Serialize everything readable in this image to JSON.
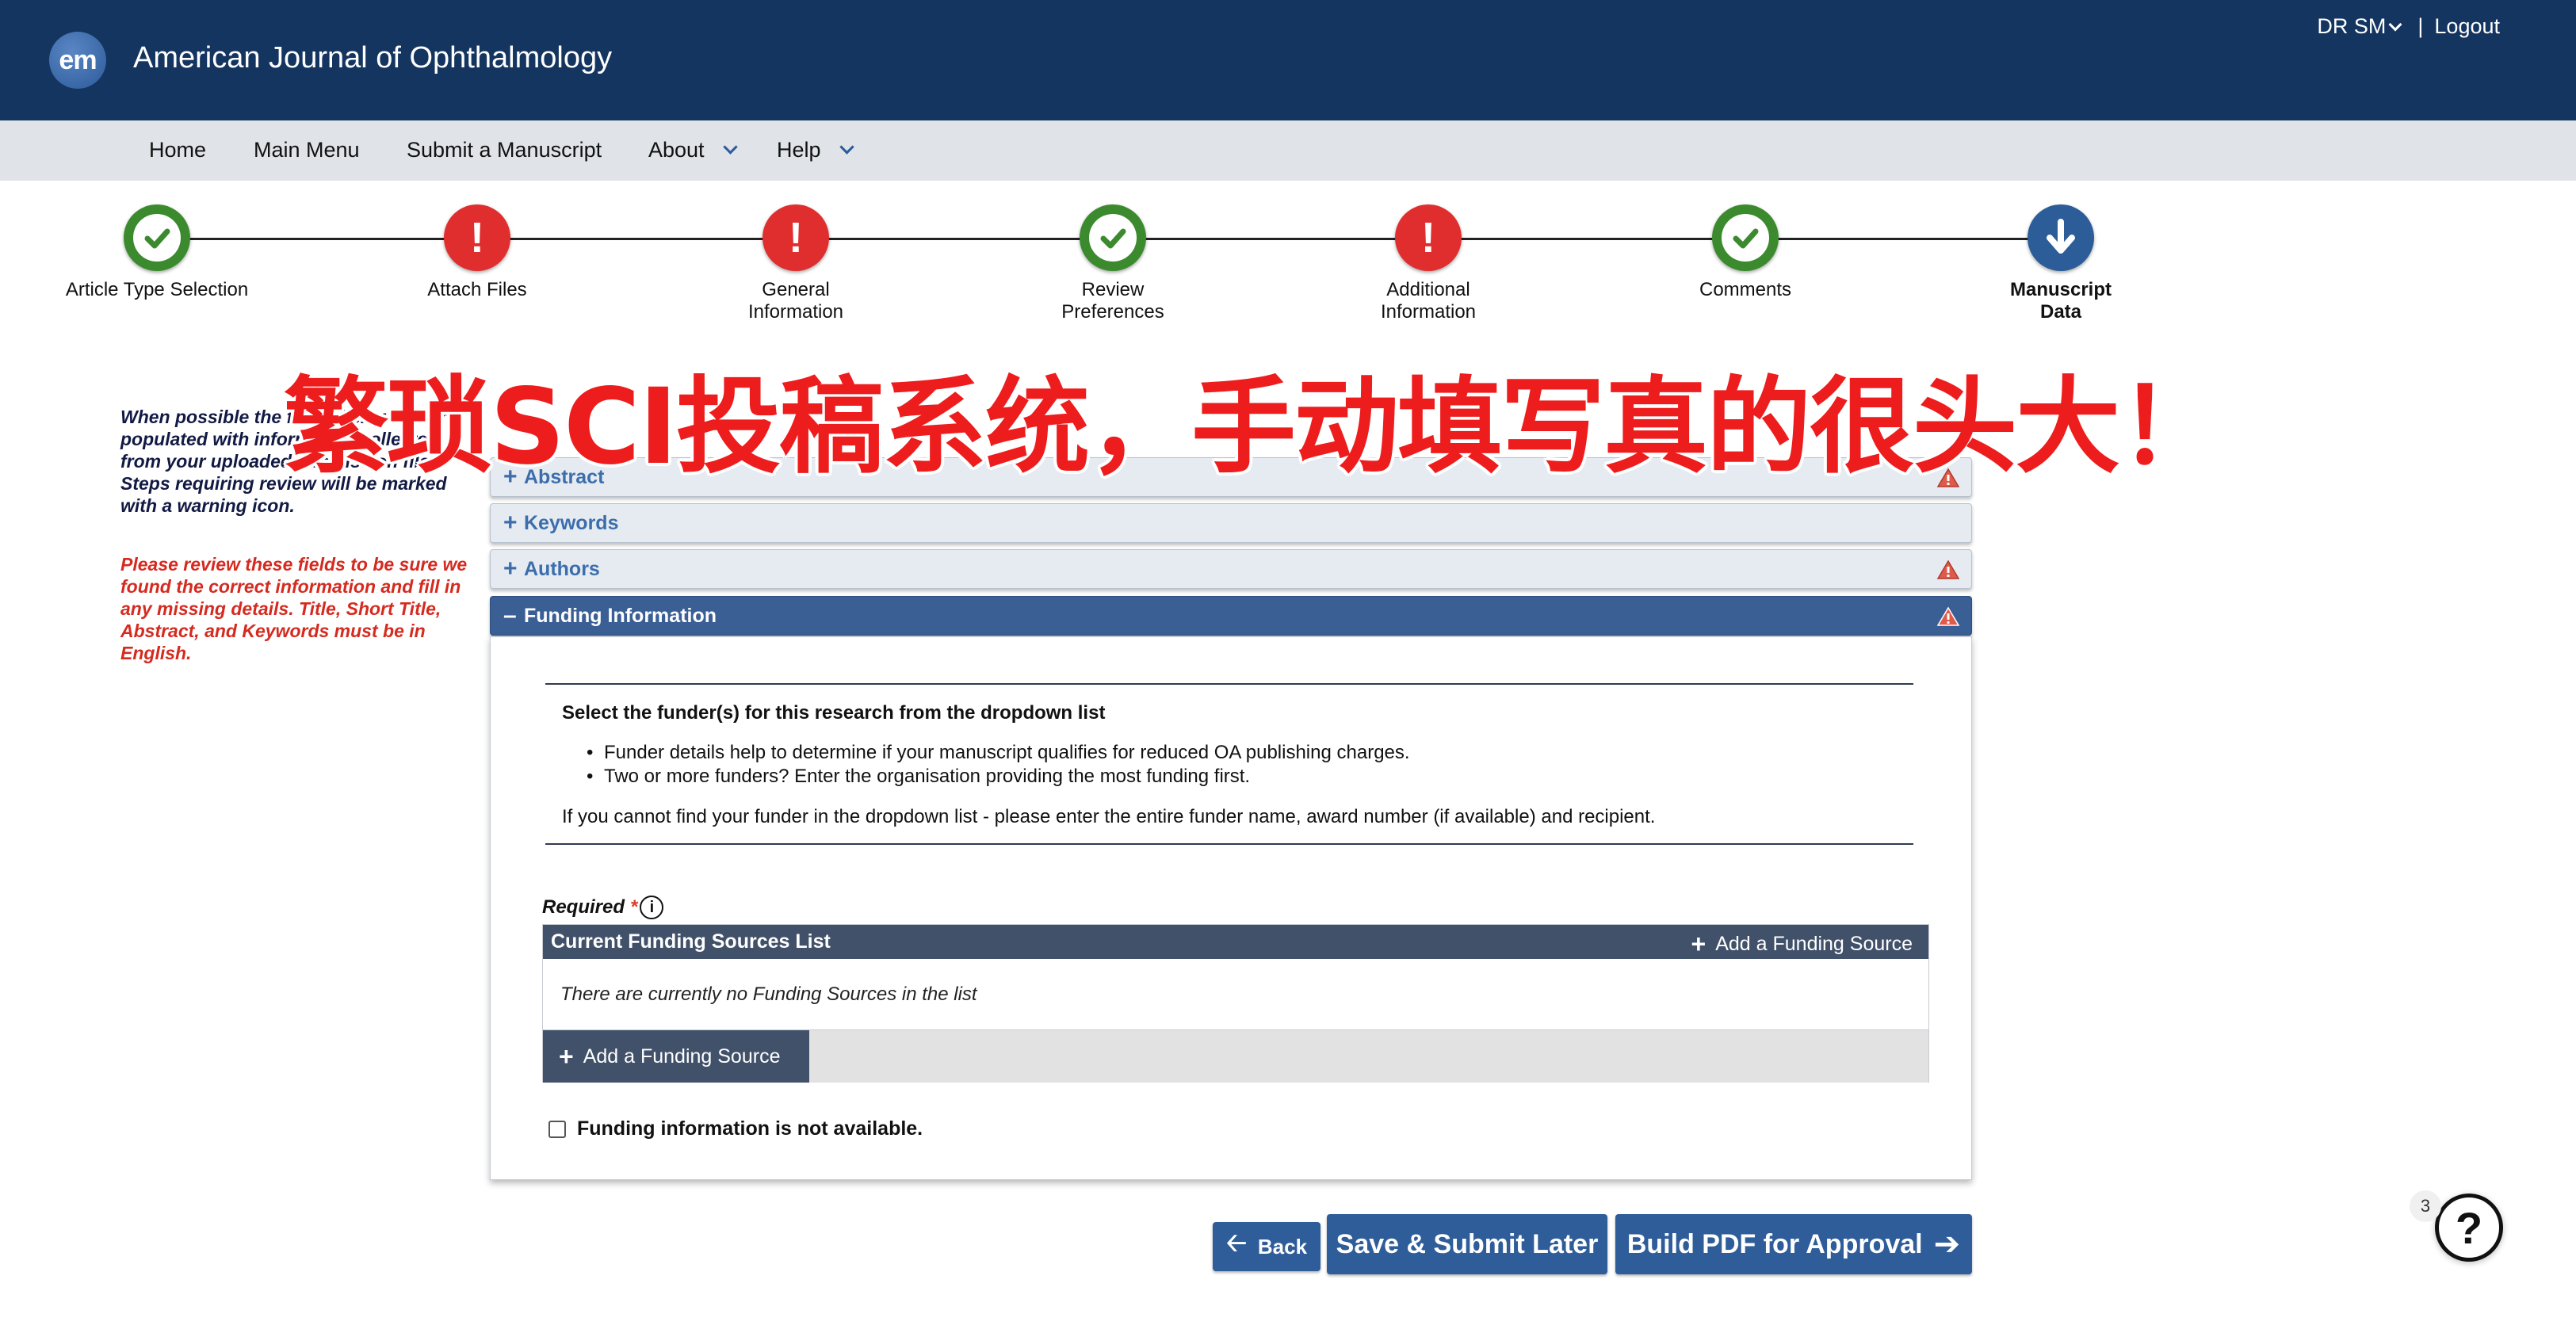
{
  "header": {
    "logo_text": "em",
    "journal_title": "American Journal of Ophthalmology",
    "user_name": "DR SM",
    "separator": "|",
    "logout_label": "Logout"
  },
  "nav": {
    "items": [
      {
        "label": "Home"
      },
      {
        "label": "Main Menu"
      },
      {
        "label": "Submit a Manuscript"
      },
      {
        "label": "About"
      },
      {
        "label": "Help"
      }
    ]
  },
  "steps": [
    {
      "label": "Article Type Selection",
      "status": "complete"
    },
    {
      "label": "Attach Files",
      "status": "warning"
    },
    {
      "label": "General Information",
      "status": "warning"
    },
    {
      "label": "Review Preferences",
      "status": "complete"
    },
    {
      "label": "Additional Information",
      "status": "warning"
    },
    {
      "label": "Comments",
      "status": "complete"
    },
    {
      "label": "Manuscript Data",
      "status": "current"
    }
  ],
  "overlay_caption": "繁琐SCI投稿系统，手动填写真的很头大！",
  "side_notes": {
    "instruction": "When possible the fields below are pre-populated with information collected from your uploaded submission file. Steps requiring review will be marked with a warning icon.",
    "warning": "Please review these fields to be sure we found the correct information and fill in any missing details. Title, Short Title, Abstract, and Keywords must be in English."
  },
  "sections": [
    {
      "label": "Abstract",
      "expanded": false,
      "has_warning": true
    },
    {
      "label": "Keywords",
      "expanded": false,
      "has_warning": false
    },
    {
      "label": "Authors",
      "expanded": false,
      "has_warning": true
    },
    {
      "label": "Funding Information",
      "expanded": true,
      "has_warning": true
    }
  ],
  "funding": {
    "heading": "Select the funder(s) for this research from the dropdown list",
    "bullets": [
      "Funder details help to determine if your manuscript qualifies for reduced OA publishing charges.",
      "Two or more funders? Enter the organisation providing the most funding first."
    ],
    "note": "If you cannot find your funder in the dropdown list - please enter the entire funder name, award number (if available) and recipient.",
    "required_label": "Required",
    "required_star": "*",
    "info_glyph": "i",
    "list_title": "Current Funding Sources List",
    "add_source_label": "Add a Funding Source",
    "empty_message": "There are currently no Funding Sources in the list",
    "not_available_label": "Funding information is not available.",
    "not_available_checked": false
  },
  "buttons": {
    "back": "Back",
    "save": "Save & Submit Later",
    "pdf": "Build PDF for Approval"
  },
  "help": {
    "count": "3",
    "glyph": "?"
  },
  "colors": {
    "header_bg": "#143560",
    "accent_blue": "#2f5d99",
    "success_green": "#3c8a2e",
    "error_red": "#e02e2e",
    "overlay_red": "#ee1d1d"
  }
}
